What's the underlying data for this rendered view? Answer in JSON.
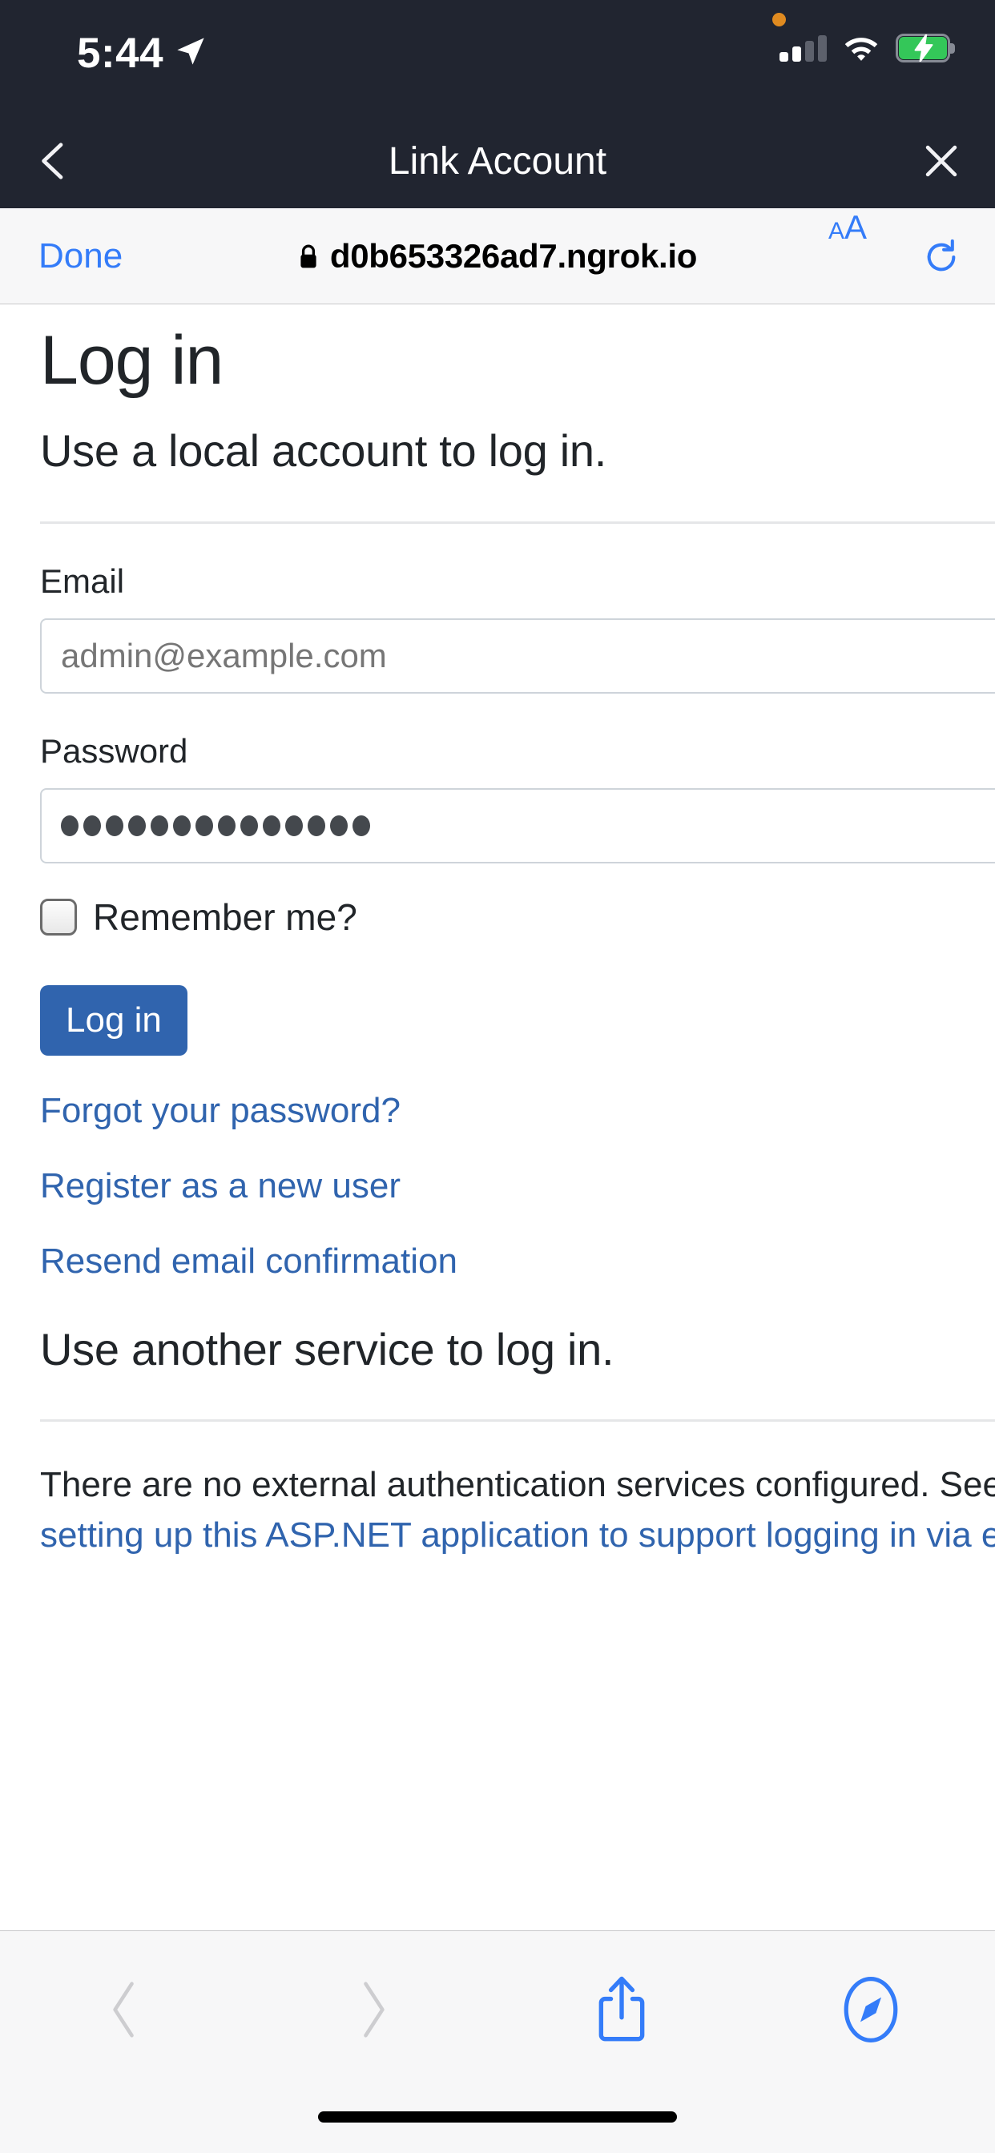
{
  "status_bar": {
    "time": "5:44",
    "location_icon": "location-arrow-icon",
    "recording_dot": "orange-recording-indicator",
    "cellular_icon": "cellular-signal-icon",
    "cellular_bars_filled": 2,
    "cellular_bars_total": 4,
    "wifi_icon": "wifi-icon",
    "battery_icon": "battery-charging-icon",
    "battery_color": "#34c759"
  },
  "nav_bar": {
    "back_icon": "chevron-left-icon",
    "title": "Link Account",
    "close_icon": "close-x-icon",
    "background_color": "#212530"
  },
  "browser_bar": {
    "done_label": "Done",
    "lock_icon": "lock-icon",
    "url": "d0b653326ad7.ngrok.io",
    "text_size_label_small": "A",
    "text_size_label_large": "A",
    "text_size_icon": "text-size-aa-icon",
    "reload_icon": "reload-icon",
    "accent_color": "#347cf9"
  },
  "page": {
    "title": "Log in",
    "subtitle": "Use a local account to log in.",
    "email": {
      "label": "Email",
      "placeholder": "admin@example.com",
      "value": ""
    },
    "password": {
      "label": "Password",
      "masked_char_count": 14,
      "value": "••••••••••••••"
    },
    "remember_me": {
      "label": "Remember me?",
      "checked": false
    },
    "login_button": "Log in",
    "login_button_color": "#3064ae",
    "links": [
      {
        "label": "Forgot your password?"
      },
      {
        "label": "Register as a new user"
      },
      {
        "label": "Resend email confirmation"
      }
    ],
    "external_section": {
      "heading": "Use another service to log in.",
      "paragraph_prefix": "There are no external authentication services configured. See this ",
      "paragraph_link": "article about setting up this ASP.NET application to support logging in via external services",
      "paragraph_suffix": "."
    },
    "link_color": "#3064ae"
  },
  "toolbar": {
    "back_icon": "chevron-left-icon",
    "back_enabled": false,
    "forward_icon": "chevron-right-icon",
    "forward_enabled": false,
    "share_icon": "share-icon",
    "tabs_icon": "safari-compass-icon",
    "accent_color": "#347cf9"
  },
  "home_indicator": "home-indicator-bar"
}
